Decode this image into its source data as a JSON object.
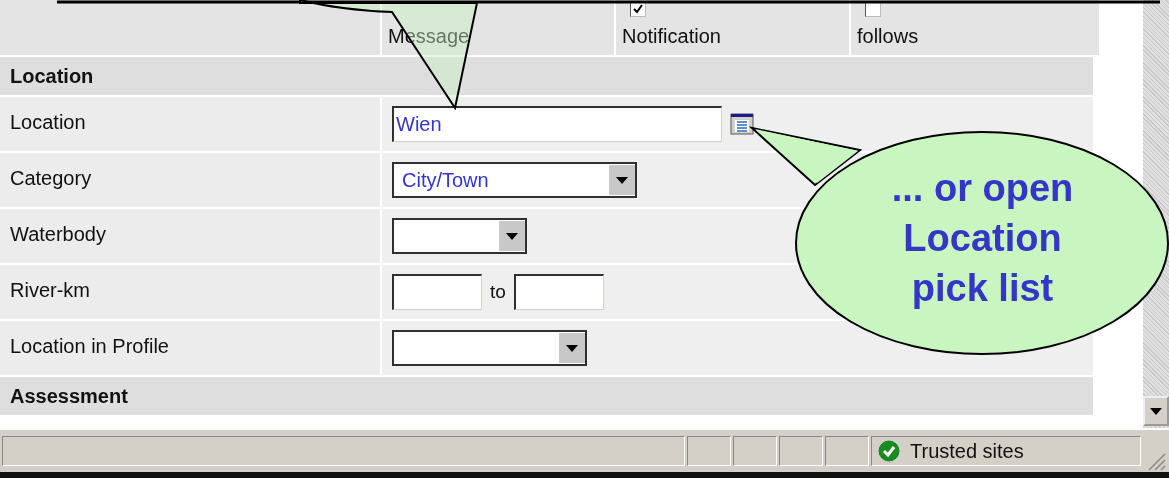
{
  "top_row": {
    "options": [
      {
        "label": "Message"
      },
      {
        "label": "Notification",
        "checked": true
      },
      {
        "label": "follows",
        "checked": false
      }
    ]
  },
  "sections": [
    {
      "title": "Location",
      "rows": [
        {
          "label": "Location",
          "kind": "text",
          "value": "Wien",
          "picker": true
        },
        {
          "label": "Category",
          "kind": "select",
          "value": "City/Town"
        },
        {
          "label": "Waterbody",
          "kind": "select"
        },
        {
          "label": "River-km",
          "kind": "range",
          "separator": "to"
        },
        {
          "label": "Location in Profile",
          "kind": "select"
        }
      ]
    },
    {
      "title": "Assessment"
    }
  ],
  "callout": {
    "text": "... or open Location pick list"
  },
  "status_bar": {
    "zone": "Trusted sites"
  }
}
